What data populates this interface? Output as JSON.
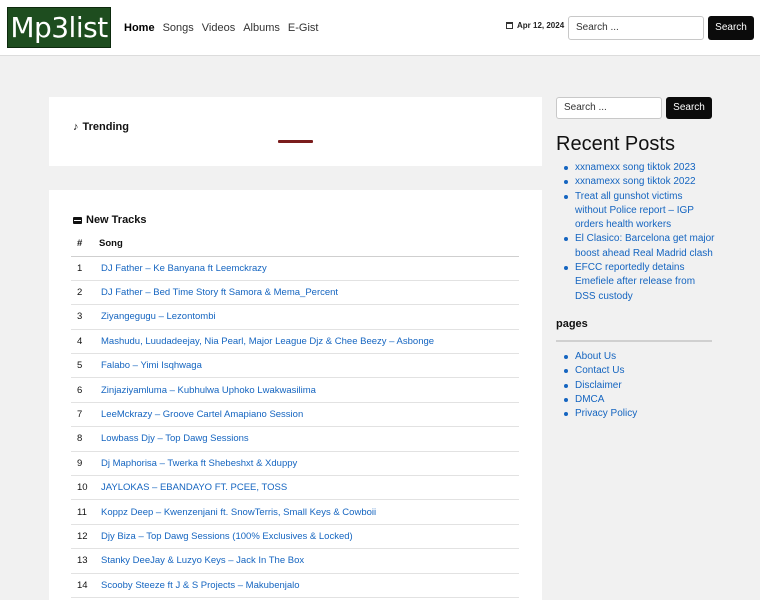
{
  "header": {
    "logo": "Mp3list",
    "nav": [
      "Home",
      "Songs",
      "Videos",
      "Albums",
      "E-Gist"
    ],
    "date": "Apr 12, 2024",
    "search_placeholder": "Search ...",
    "search_button": "Search"
  },
  "trending": {
    "title": "Trending"
  },
  "tracks": {
    "title": "New Tracks",
    "col_num": "#",
    "col_song": "Song",
    "rows": [
      {
        "n": "1",
        "song": "DJ Father – Ke Banyana ft Leemckrazy"
      },
      {
        "n": "2",
        "song": "DJ Father – Bed Time Story ft Samora & Mema_Percent"
      },
      {
        "n": "3",
        "song": "Ziyangegugu – Lezontombi"
      },
      {
        "n": "4",
        "song": "Mashudu, Luudadeejay, Nia Pearl, Major League Djz & Chee Beezy – Asbonge"
      },
      {
        "n": "5",
        "song": "Falabo – Yimi Isqhwaga"
      },
      {
        "n": "6",
        "song": "Zinjaziyamluma – Kubhulwa Uphoko Lwakwasilima"
      },
      {
        "n": "7",
        "song": "LeeMckrazy – Groove Cartel Amapiano Session"
      },
      {
        "n": "8",
        "song": "Lowbass Djy – Top Dawg Sessions"
      },
      {
        "n": "9",
        "song": "Dj Maphorisa – Twerka ft Shebeshxt & Xduppy"
      },
      {
        "n": "10",
        "song": "JAYLOKAS – EBANDAYO FT. PCEE, TOSS"
      },
      {
        "n": "11",
        "song": "Koppz Deep – Kwenzenjani ft. SnowTerris, Small Keys & Cowboii"
      },
      {
        "n": "12",
        "song": "Djy Biza – Top Dawg Sessions (100% Exclusives & Locked)"
      },
      {
        "n": "13",
        "song": "Stanky DeeJay & Luzyo Keys – Jack In The Box"
      },
      {
        "n": "14",
        "song": "Scooby Steeze ft J & S Projects – Makubenjalo"
      }
    ]
  },
  "sidebar": {
    "search_placeholder": "Search ...",
    "search_button": "Search",
    "recent_title": "Recent Posts",
    "recent": [
      "xxnamexx song tiktok 2023",
      "xxnamexx song tiktok 2022",
      "Treat all gunshot victims without Police report – IGP orders health workers",
      "El Clasico: Barcelona get major boost ahead Real Madrid clash",
      "EFCC reportedly detains Emefiele after release from DSS custody"
    ],
    "pages_title": "pages",
    "pages": [
      "About Us",
      "Contact Us",
      "Disclaimer",
      "DMCA",
      "Privacy Policy"
    ]
  }
}
